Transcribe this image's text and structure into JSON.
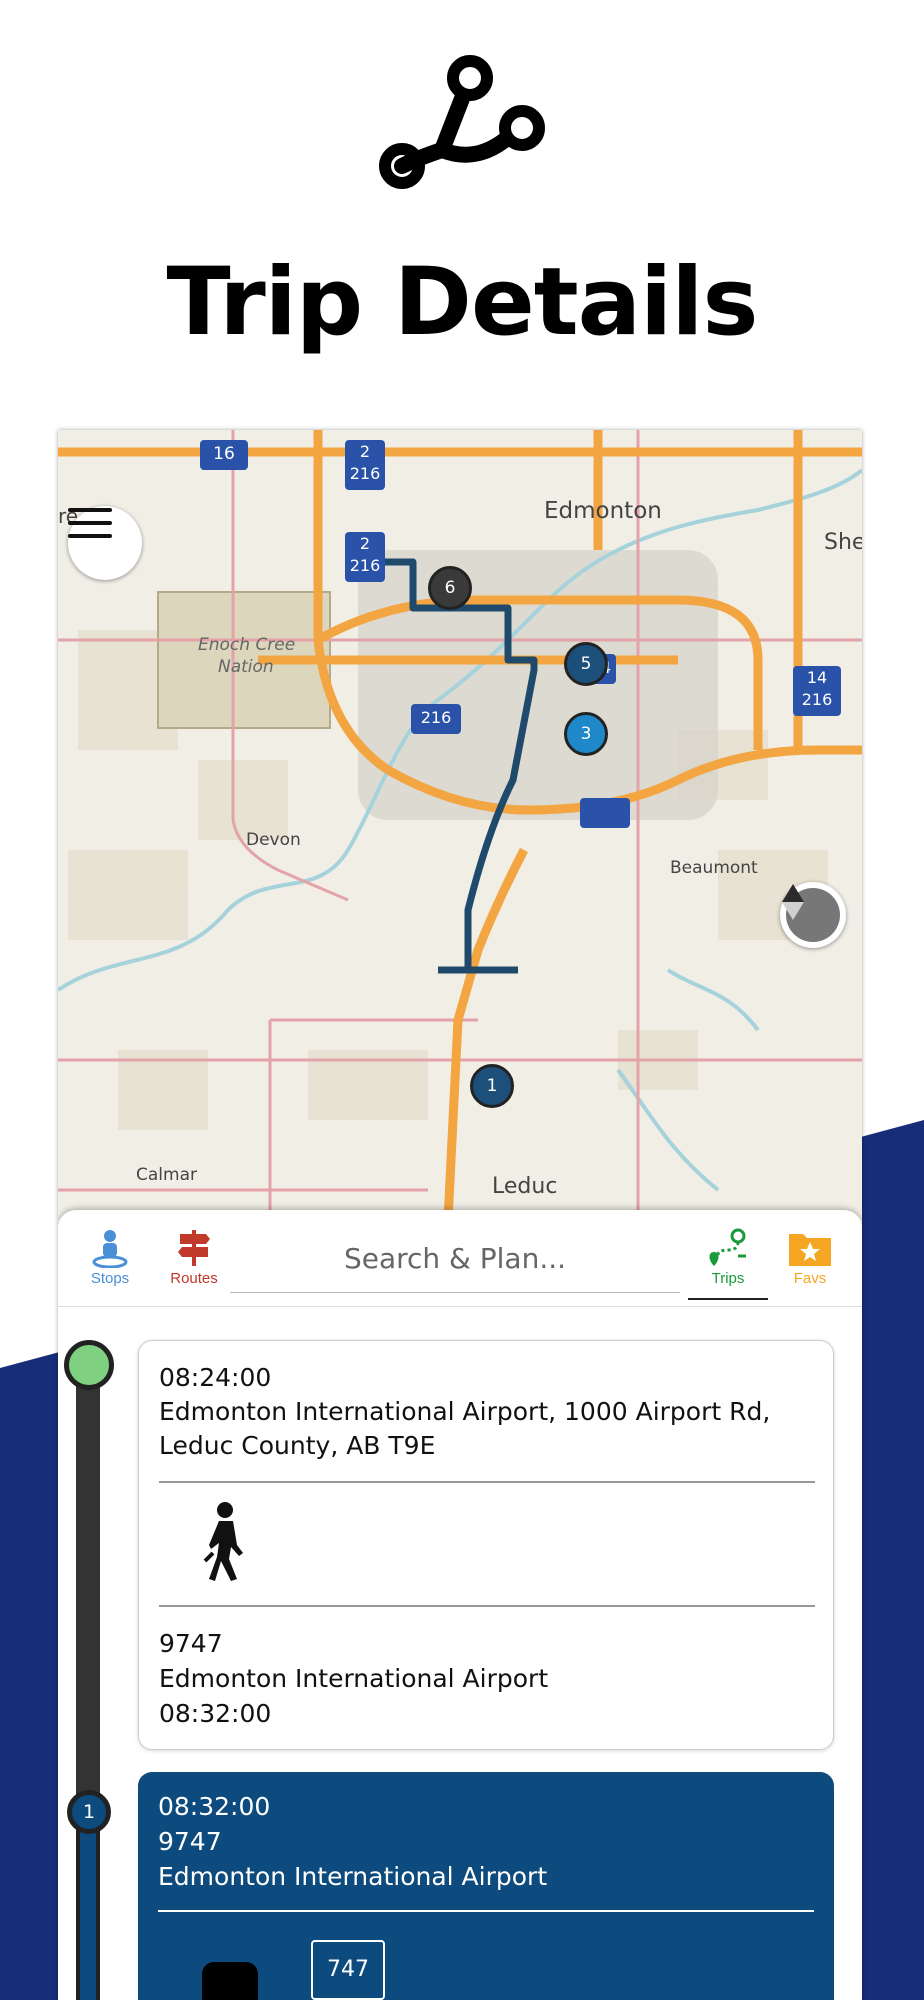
{
  "hero": {
    "title": "Trip Details",
    "icon": "route-icon"
  },
  "colors": {
    "navy_band": "#172d7a",
    "route_line": "#0d4a7d",
    "trips_green": "#1a9a3a",
    "routes_red": "#c0392b",
    "stops_blue": "#4a90d9",
    "favs_orange": "#f5a623"
  },
  "map": {
    "labels": {
      "city": "Edmonton",
      "reserve_line1": "Enoch Cree",
      "reserve_line2": "Nation",
      "devon": "Devon",
      "beaumont": "Beaumont",
      "calmar": "Calmar",
      "leduc": "Leduc",
      "edge_left": "re",
      "edge_right": "She"
    },
    "shields": {
      "hwy16": "16",
      "hwy2a_top": "2",
      "hwy2a_bottom": "216",
      "hwy2b_top": "2",
      "hwy2b_bottom": "216",
      "hwy216": "216",
      "hwy14_top": "14",
      "hwy14_bottom": "216",
      "partial": "4"
    },
    "stops": [
      "1",
      "3",
      "5",
      "6"
    ]
  },
  "tabs": {
    "stops": "Stops",
    "routes": "Routes",
    "trips": "Trips",
    "favs": "Favs"
  },
  "search": {
    "placeholder": "Search & Plan..."
  },
  "timeline": {
    "start_card": {
      "depart_time": "08:24:00",
      "address_line1": "Edmonton International Airport, 1000 Airport Rd,",
      "address_line2": "Leduc County, AB T9E",
      "stop_id": "9747",
      "stop_name": "Edmonton International Airport",
      "arrive_time": "08:32:00"
    },
    "leg_card": {
      "stop_number": "1",
      "time": "08:32:00",
      "stop_id": "9747",
      "stop_name": "Edmonton International Airport",
      "route_badge": "747"
    }
  }
}
